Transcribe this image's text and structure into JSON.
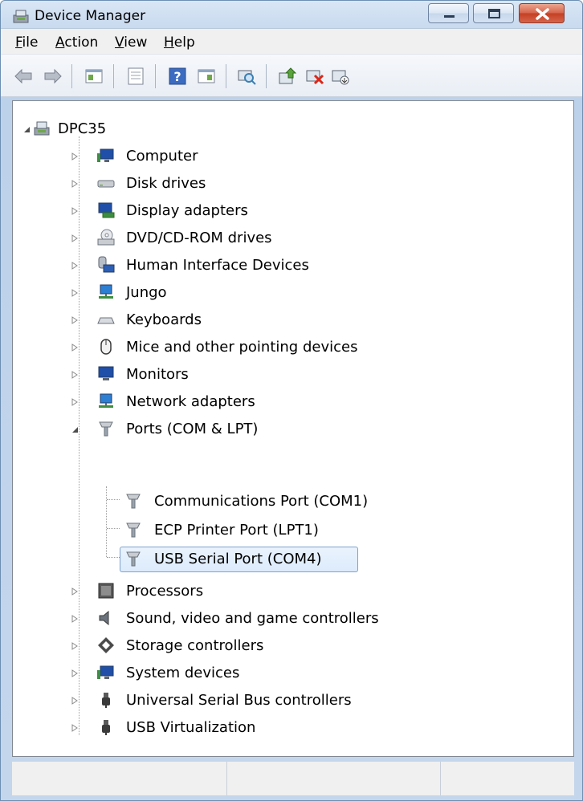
{
  "window": {
    "title": "Device Manager"
  },
  "menu": [
    "File",
    "Action",
    "View",
    "Help"
  ],
  "toolbar": [
    "back-icon",
    "forward-icon",
    "show-hide-console-tree-icon",
    "properties-icon",
    "help-icon",
    "show-action-pane-icon",
    "scan-hardware-icon",
    "update-driver-icon",
    "uninstall-icon",
    "disable-icon"
  ],
  "tree": {
    "root": "DPC35",
    "categories": [
      "Computer",
      "Disk drives",
      "Display adapters",
      "DVD/CD-ROM drives",
      "Human Interface Devices",
      "Jungo",
      "Keyboards",
      "Mice and other pointing devices",
      "Monitors",
      "Network adapters",
      "Ports (COM & LPT)",
      "Processors",
      "Sound, video and game controllers",
      "Storage controllers",
      "System devices",
      "Universal Serial Bus controllers",
      "USB Virtualization"
    ],
    "ports_children": [
      "Communications Port (COM1)",
      "ECP Printer Port (LPT1)",
      "USB Serial Port (COM4)"
    ],
    "selected": "USB Serial Port (COM4)"
  },
  "colors": {
    "accent": "#3c7fb1",
    "close": "#c33f24",
    "selection": "#dcebfc"
  }
}
